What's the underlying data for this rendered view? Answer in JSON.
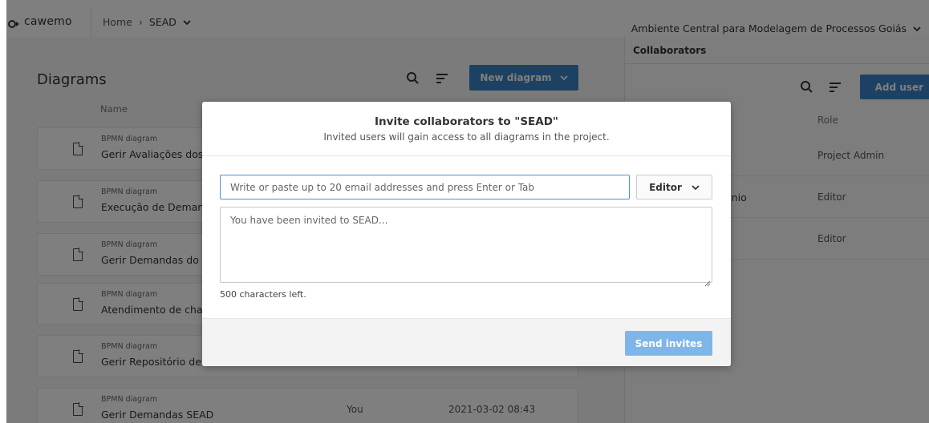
{
  "topbar": {
    "brand": "cawemo",
    "breadcrumb": {
      "home": "Home",
      "separator": "›",
      "current": "SEAD"
    },
    "organization": "Ambiente Central para Modelagem de Processos Goiás"
  },
  "diagrams": {
    "title": "Diagrams",
    "new_button": "New diagram",
    "column_name": "Name",
    "rows": [
      {
        "kind": "BPMN diagram",
        "title": "Gerir Avaliações dos",
        "owner": "",
        "date": ""
      },
      {
        "kind": "BPMN diagram",
        "title": "Execução de Demanc",
        "owner": "",
        "date": ""
      },
      {
        "kind": "BPMN diagram",
        "title": "Gerir Demandas do G",
        "owner": "",
        "date": ""
      },
      {
        "kind": "BPMN diagram",
        "title": "Atendimento de char",
        "owner": "",
        "date": ""
      },
      {
        "kind": "BPMN diagram",
        "title": "Gerir Repositório de Processos",
        "owner": "",
        "date": ""
      },
      {
        "kind": "BPMN diagram",
        "title": "Gerir Demandas SEAD",
        "owner": "You",
        "date": "2021-03-02 08:43"
      }
    ]
  },
  "collaborators": {
    "title": "Collaborators",
    "add_button": "Add user",
    "column_role": "Role",
    "rows": [
      {
        "name": "",
        "role": "Project Admin"
      },
      {
        "name": "ênio",
        "role": "Editor"
      },
      {
        "name": "",
        "role": "Editor"
      }
    ]
  },
  "modal": {
    "title": "Invite collaborators to \"SEAD\"",
    "subtitle": "Invited users will gain access to all diagrams in the project.",
    "email_placeholder": "Write or paste up to 20 email addresses and press Enter or Tab",
    "role_value": "Editor",
    "message_placeholder": "You have been invited to SEAD...",
    "chars_left": "500 characters left.",
    "send_button": "Send invites"
  },
  "colors": {
    "primary": "#3b82c4",
    "primary_disabled": "#7fb6ea",
    "input_focus": "#4a90d9"
  }
}
